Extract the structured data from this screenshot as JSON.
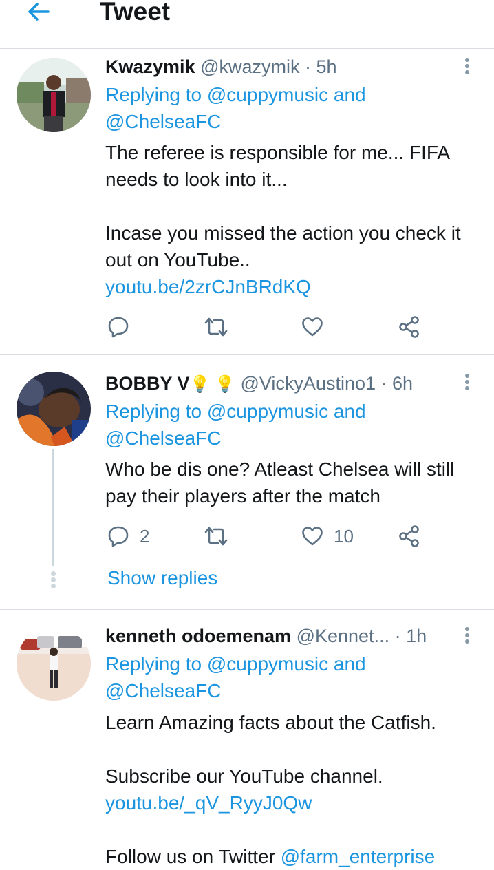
{
  "header": {
    "title": "Tweet",
    "back_icon": "arrow-left-icon"
  },
  "tweets": [
    {
      "name": "Kwazymik",
      "handle": "@kwazymik",
      "time": "· 5h",
      "replying_prefix": "Replying to",
      "replying_to": "@cuppymusic and",
      "replying_to_2": "@ChelseaFC",
      "text_1": "The referee  is responsible for me... FIFA needs to look into it...",
      "text_2": "Incase you missed the action you check it out on YouTube..",
      "link": "youtu.be/2zrCJnBRdKQ",
      "reply_count": "",
      "like_count": ""
    },
    {
      "name": "BOBBY V",
      "name_emoji": "💡 💡",
      "handle": "@VickyAustino1",
      "time": "· 6h",
      "replying_prefix": "Replying to",
      "replying_to": "@cuppymusic and",
      "replying_to_2": "@ChelseaFC",
      "text_1": "Who be dis one? Atleast Chelsea will still pay their players after the match",
      "reply_count": "2",
      "like_count": "10",
      "show_replies": "Show replies"
    },
    {
      "name": "kenneth odoemenam",
      "handle": "@Kennet...",
      "time": "· 1h",
      "replying_prefix": "Replying to",
      "replying_to": "@cuppymusic and",
      "replying_to_2": "@ChelseaFC",
      "text_1": "Learn Amazing facts about the Catfish.",
      "text_2": "Subscribe our YouTube channel.",
      "link": "youtu.be/_qV_RyyJ0Qw",
      "text_3": "Follow us on Twitter",
      "mention": "@farm_enterprise"
    }
  ],
  "colors": {
    "accent": "#1b95e0",
    "secondary_text": "#5b7083",
    "divider": "#d9dde1"
  }
}
